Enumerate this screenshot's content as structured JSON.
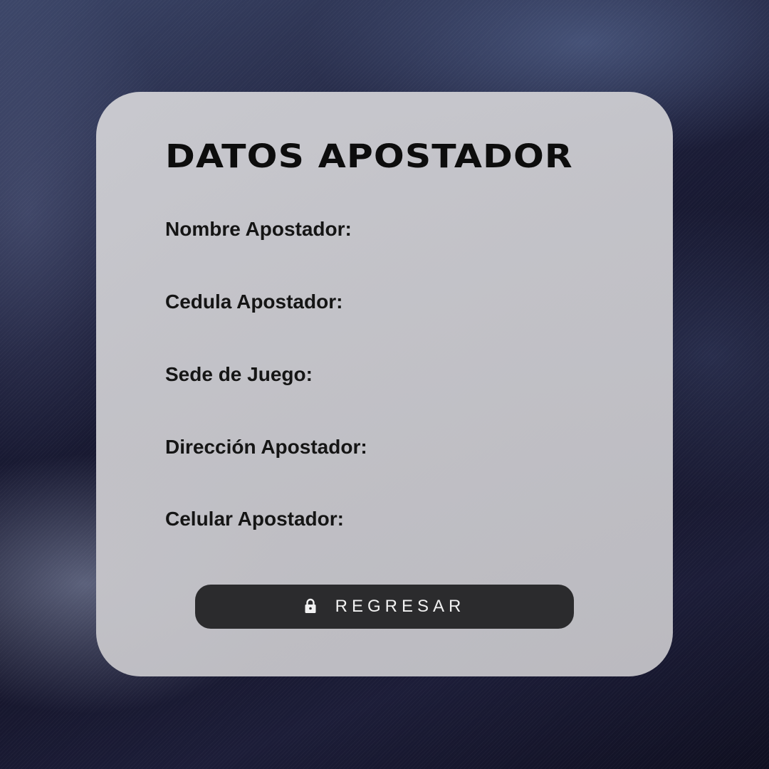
{
  "card": {
    "title": "DATOS APOSTADOR",
    "fields": [
      {
        "label": "Nombre Apostador:"
      },
      {
        "label": "Cedula Apostador:"
      },
      {
        "label": "Sede de Juego:"
      },
      {
        "label": "Dirección Apostador:"
      },
      {
        "label": "Celular Apostador:"
      }
    ],
    "button": {
      "label": "REGRESAR",
      "icon": "lock-icon"
    }
  },
  "colors": {
    "card_background": "#c3c2c7",
    "button_background": "#2b2b2d",
    "title_text": "#0d0d0d",
    "button_text": "#f2f2f2",
    "page_background": "#1b1d38"
  }
}
